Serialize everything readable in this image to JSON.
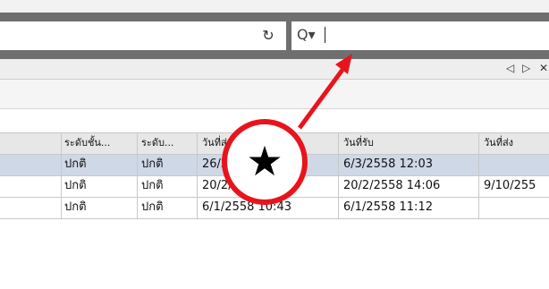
{
  "toolbar": {
    "reload_glyph": "↻",
    "search_glyph": "Q▾"
  },
  "panel": {
    "nav_prev": "◁",
    "nav_next": "▷",
    "nav_close": "✕"
  },
  "table": {
    "columns": [
      "ระดับชั้น...",
      "ระดับ...",
      "วันที่ส่ง",
      "วันที่รับ",
      "วันที่ส่ง"
    ],
    "rows": [
      [
        "ปกติ",
        "ปกติ",
        "26/2/2558 15:42",
        "6/3/2558 12:03",
        ""
      ],
      [
        "ปกติ",
        "ปกติ",
        "20/2/2558 14:03",
        "20/2/2558 14:06",
        "9/10/255"
      ],
      [
        "ปกติ",
        "ปกติ",
        "6/1/2558 10:43",
        "6/1/2558 11:12",
        ""
      ]
    ]
  },
  "annotation": {
    "star_glyph": "★",
    "circle_color": "#e8141c",
    "arrow_color": "#e8141c"
  }
}
